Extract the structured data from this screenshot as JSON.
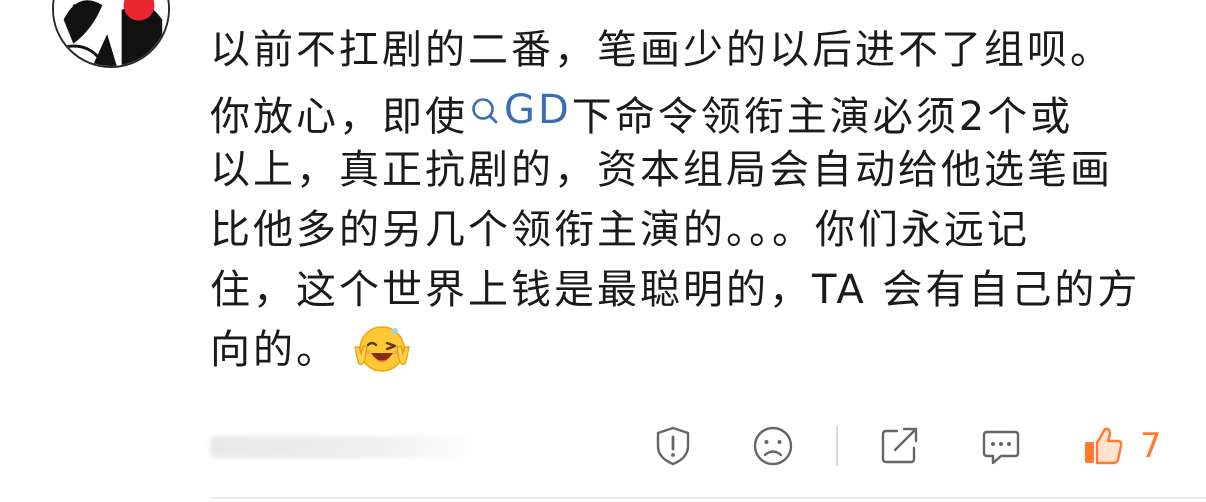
{
  "comment": {
    "lines": [
      "以前不扛剧的二番，笔画少的以后进不了组呗。",
      "你放心，即使",
      "下命令领衔主演必须2个或",
      "以上，真正抗剧的，资本组局会自动给他选笔画",
      "比他多的另几个领衔主演的。。。你们永远记",
      "住，这个世界上钱是最聪明的，TA 会有自己的方",
      "向的。"
    ],
    "topic": "GD",
    "topic_icon": "search-icon",
    "emoji": "laughing-victory-emoji",
    "colors": {
      "text": "#1a1a1a",
      "link": "#3a6fb6",
      "like": "#ff7a2e"
    }
  },
  "actions": {
    "report_icon": "report-icon",
    "dislike_icon": "sad-face-icon",
    "share_icon": "share-icon",
    "reply_icon": "comment-icon",
    "like_icon": "thumbs-up-icon",
    "like_count": "7"
  }
}
